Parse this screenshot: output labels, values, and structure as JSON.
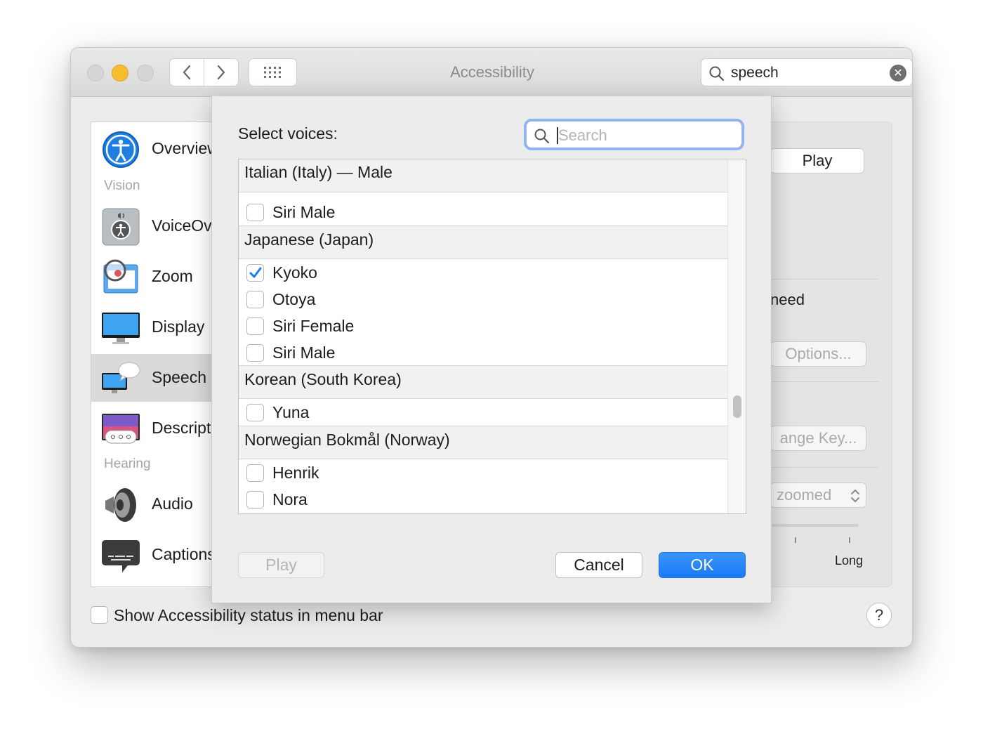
{
  "window": {
    "title": "Accessibility"
  },
  "toolbar": {
    "search_value": "speech",
    "clear_glyph": "✕"
  },
  "sidebar": {
    "items": [
      {
        "label": "Overview",
        "icon": "accessibility-icon"
      },
      {
        "label": "VoiceOver",
        "icon": "voiceover-icon"
      },
      {
        "label": "Zoom",
        "icon": "zoom-icon"
      },
      {
        "label": "Display",
        "icon": "display-icon"
      },
      {
        "label": "Speech",
        "icon": "speech-icon",
        "selected": true
      },
      {
        "label": "Descriptions",
        "icon": "descriptions-icon"
      },
      {
        "label": "Audio",
        "icon": "audio-icon"
      },
      {
        "label": "Captions",
        "icon": "captions-icon"
      }
    ],
    "section_vision": "Vision",
    "section_hearing": "Hearing"
  },
  "background_panel": {
    "play_label": "Play",
    "need_text": "need",
    "options_label": "Options...",
    "change_key_label": "ange Key...",
    "zoomed_value": "zoomed",
    "long_label": "Long"
  },
  "footer": {
    "show_status_label": "Show Accessibility status in menu bar",
    "help_label": "?"
  },
  "sheet": {
    "title": "Select voices:",
    "search_placeholder": "Search",
    "groups": [
      {
        "header": "Italian (Italy) — Male",
        "voices": [
          {
            "name": "Siri Male",
            "checked": false
          }
        ]
      },
      {
        "header": "Japanese (Japan)",
        "voices": [
          {
            "name": "Kyoko",
            "checked": true
          },
          {
            "name": "Otoya",
            "checked": false
          },
          {
            "name": "Siri Female",
            "checked": false
          },
          {
            "name": "Siri Male",
            "checked": false
          }
        ]
      },
      {
        "header": "Korean (South Korea)",
        "voices": [
          {
            "name": "Yuna",
            "checked": false
          }
        ]
      },
      {
        "header": "Norwegian Bokmål (Norway)",
        "voices": [
          {
            "name": "Henrik",
            "checked": false
          },
          {
            "name": "Nora",
            "checked": false
          }
        ]
      }
    ],
    "play_label": "Play",
    "cancel_label": "Cancel",
    "ok_label": "OK"
  },
  "colors": {
    "accent": "#1a7af5",
    "focus_ring": "#8fb4f2",
    "traffic_yellow": "#f6be2f"
  }
}
